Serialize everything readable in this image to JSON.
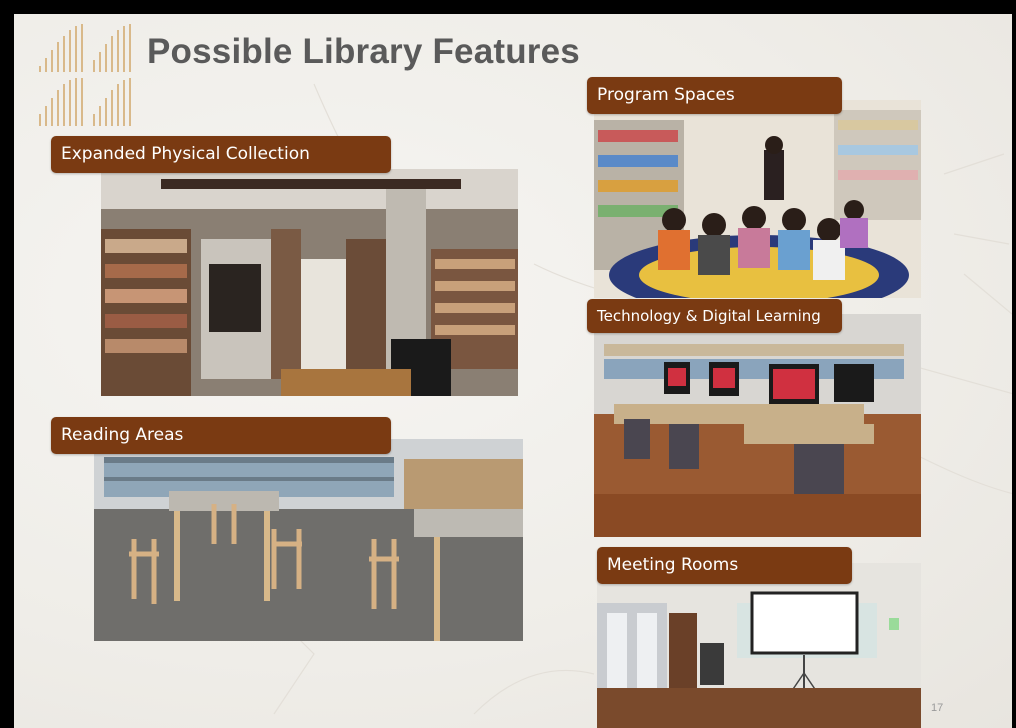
{
  "slide": {
    "title": "Possible Library Features",
    "page_number": "17"
  },
  "sections": {
    "collection": "Expanded Physical Collection",
    "program": "Program Spaces",
    "reading": "Reading Areas",
    "technology": "Technology & Digital Learning",
    "meeting": "Meeting Rooms"
  },
  "colors": {
    "label_bg": "#7a3a12",
    "title": "#5a5a5a",
    "logo": "#d9b98a"
  },
  "icons": {
    "logo": "library-logo-icon"
  }
}
